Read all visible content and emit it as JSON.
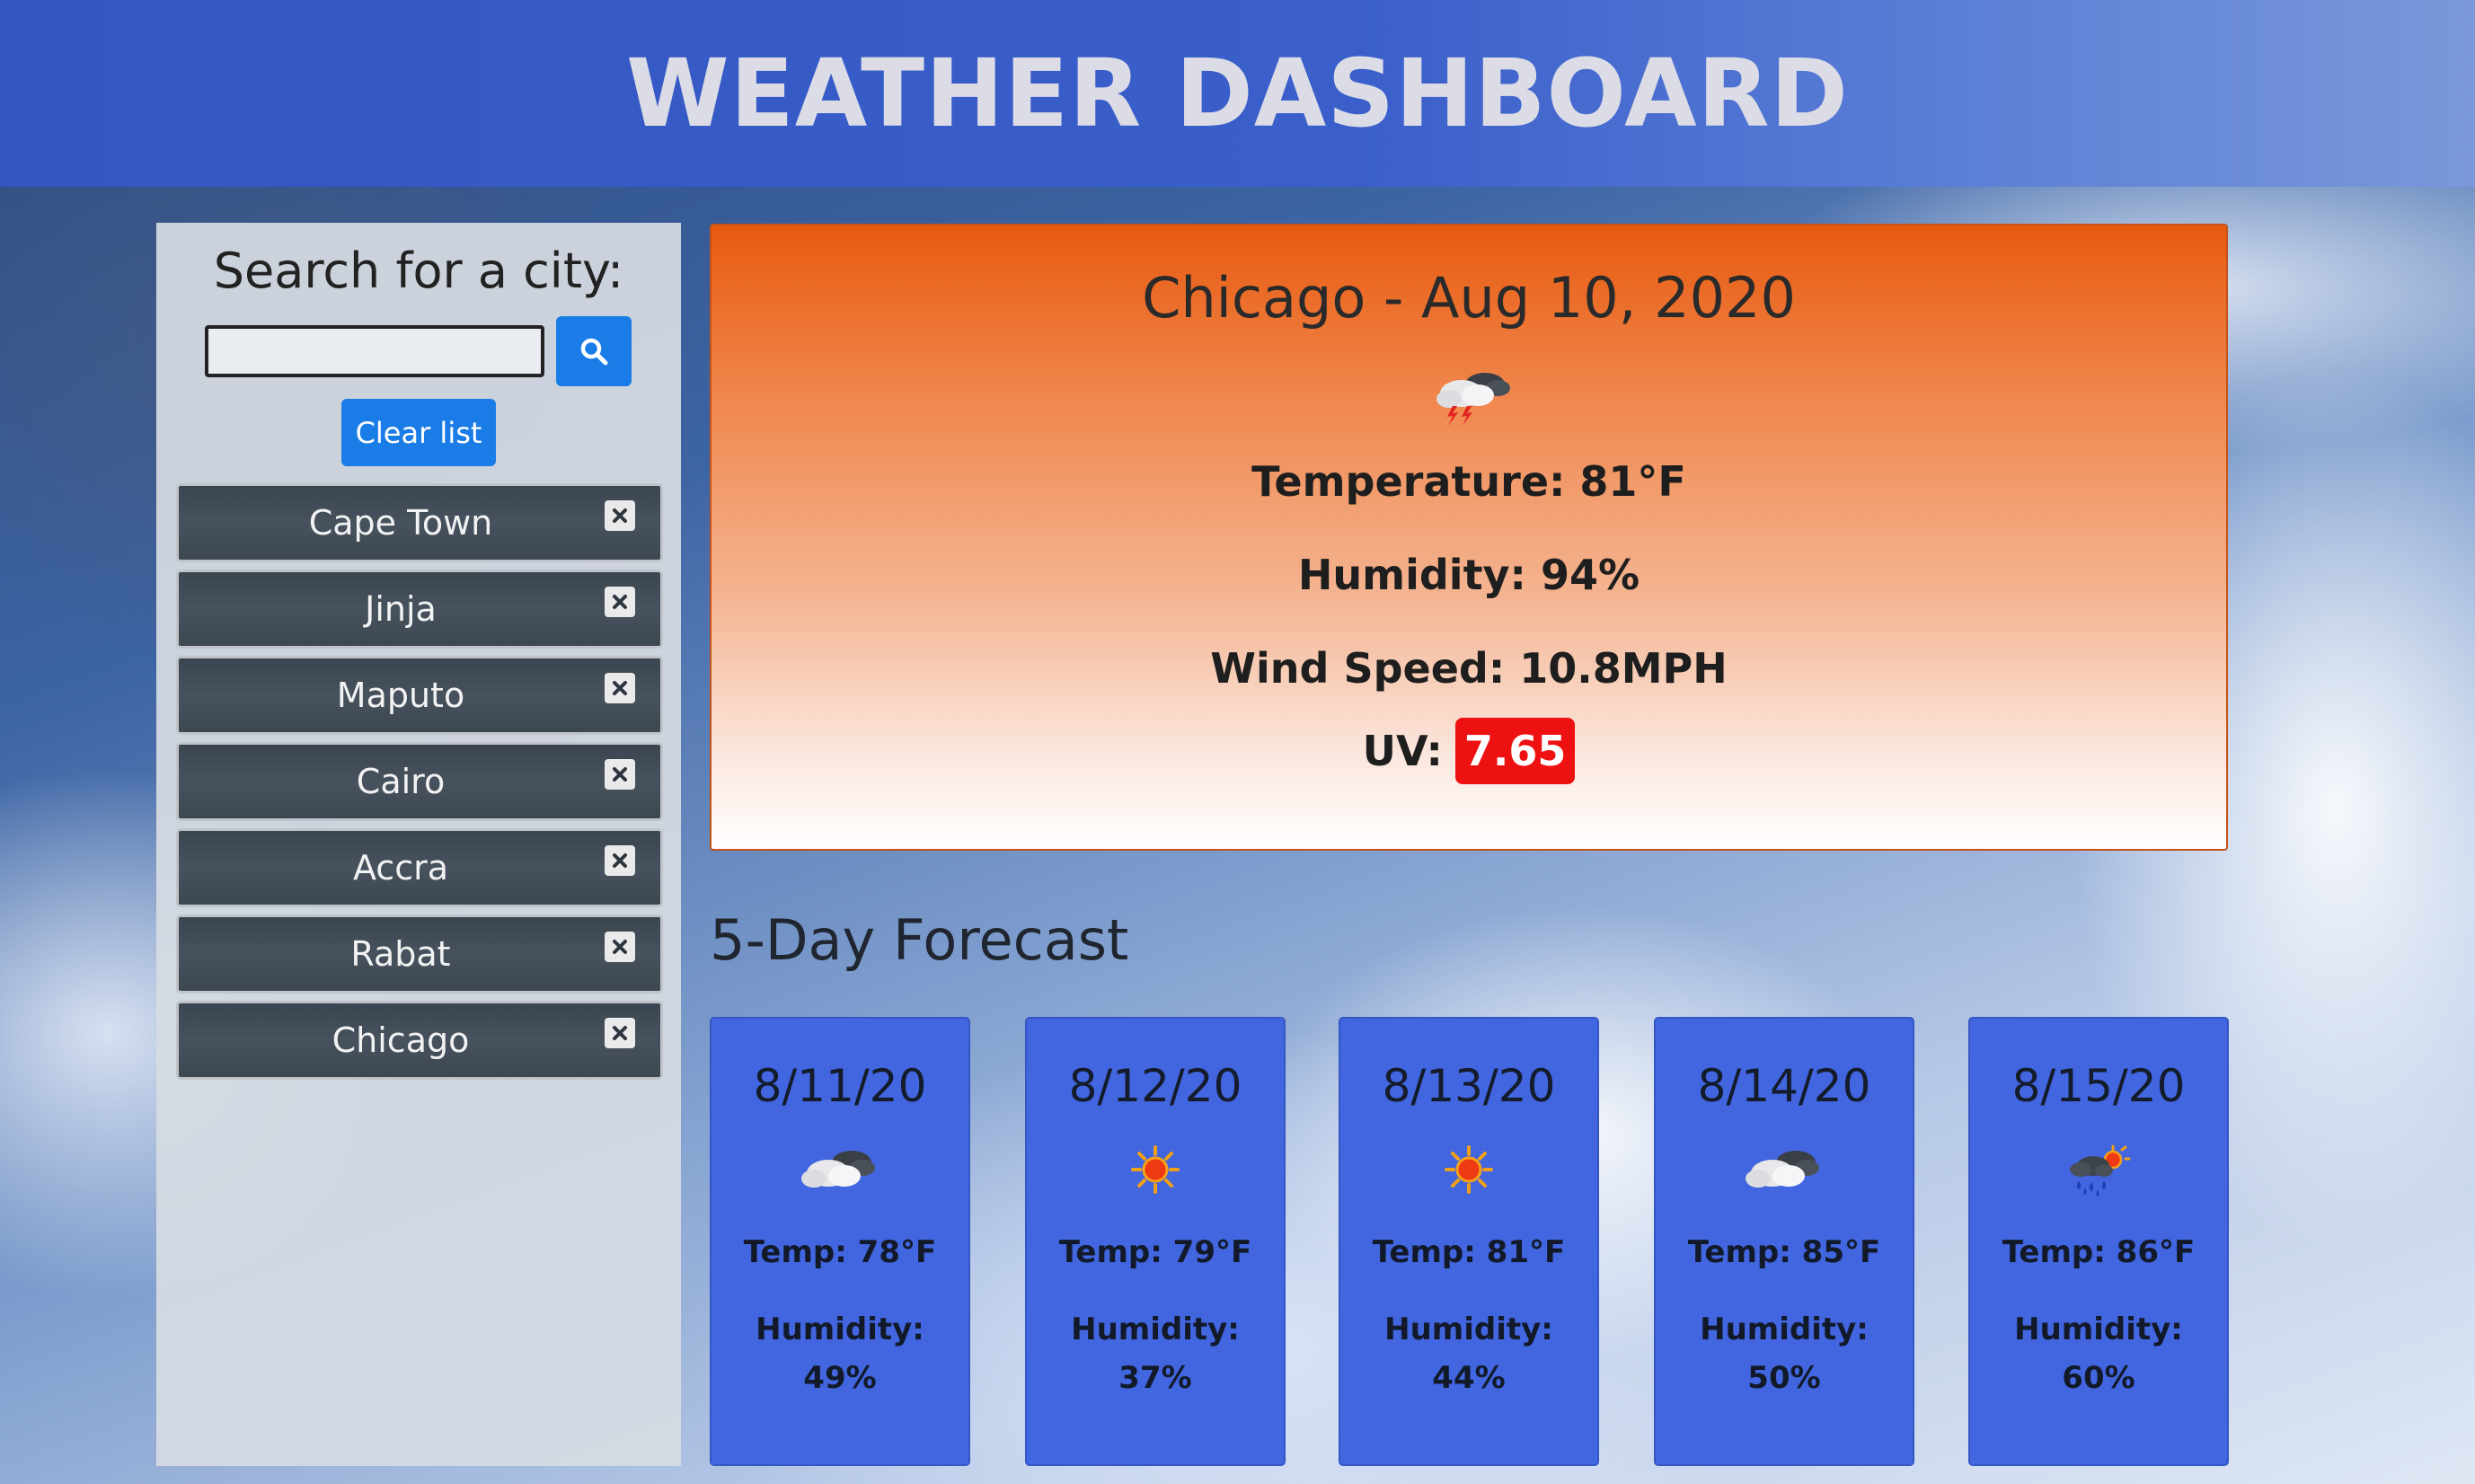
{
  "header": {
    "title": "WEATHER DASHBOARD"
  },
  "sidebar": {
    "search_title": "Search for a city:",
    "search_input_value": "",
    "search_button_icon": "search-icon",
    "clear_label": "Clear list",
    "cities": [
      {
        "name": "Cape Town"
      },
      {
        "name": "Jinja"
      },
      {
        "name": "Maputo"
      },
      {
        "name": "Cairo"
      },
      {
        "name": "Accra"
      },
      {
        "name": "Rabat"
      },
      {
        "name": "Chicago"
      }
    ]
  },
  "current": {
    "title": "Chicago - Aug 10, 2020",
    "icon": "thunderstorm-icon",
    "temperature": "Temperature: 81°F",
    "humidity": "Humidity: 94%",
    "wind": "Wind Speed: 10.8MPH",
    "uv_label": "UV:",
    "uv_value": "7.65"
  },
  "forecast": {
    "title": "5-Day Forecast",
    "days": [
      {
        "date": "8/11/20",
        "icon": "cloudy-icon",
        "temp": "Temp: 78°F",
        "humidity_label": "Humidity:",
        "humidity": "49%"
      },
      {
        "date": "8/12/20",
        "icon": "sun-icon",
        "temp": "Temp: 79°F",
        "humidity_label": "Humidity:",
        "humidity": "37%"
      },
      {
        "date": "8/13/20",
        "icon": "sun-icon",
        "temp": "Temp: 81°F",
        "humidity_label": "Humidity:",
        "humidity": "44%"
      },
      {
        "date": "8/14/20",
        "icon": "cloudy-icon",
        "temp": "Temp: 85°F",
        "humidity_label": "Humidity:",
        "humidity": "50%"
      },
      {
        "date": "8/15/20",
        "icon": "rain-sun-icon",
        "temp": "Temp: 86°F",
        "humidity_label": "Humidity:",
        "humidity": "60%"
      }
    ]
  },
  "colors": {
    "header_blue": "#3356c0",
    "accent_blue": "#1a7ce6",
    "card_orange": "#e85b10",
    "forecast_blue": "#4166e0",
    "uv_red": "#ee1111"
  }
}
